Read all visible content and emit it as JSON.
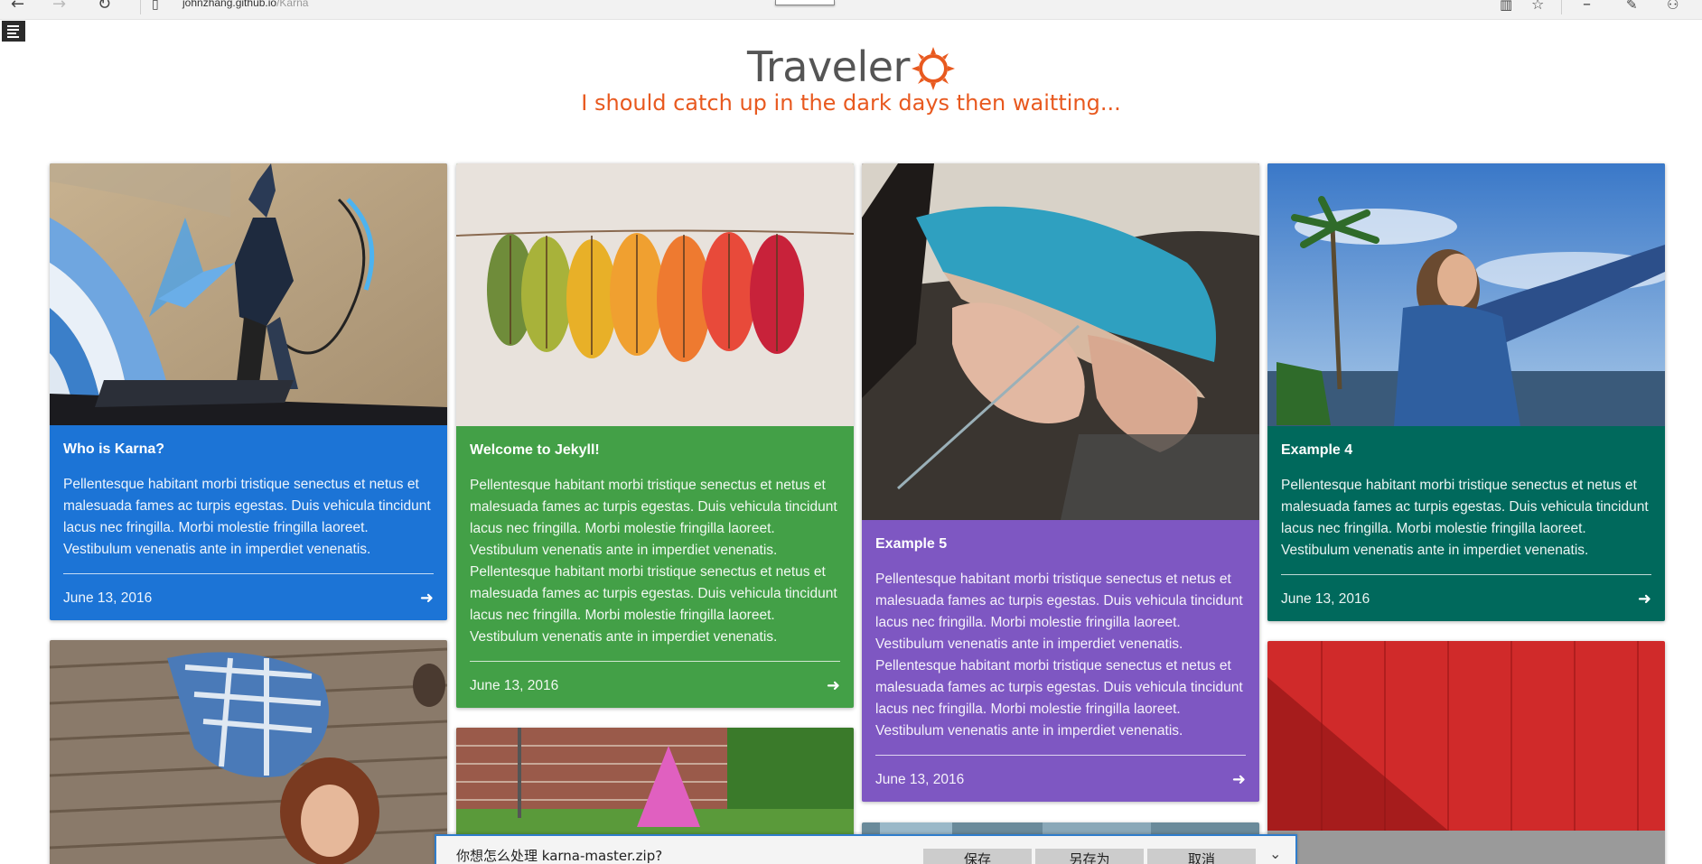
{
  "browser": {
    "url_host": "johnzhang.github.io",
    "url_path": "/Karna"
  },
  "site": {
    "title": "Traveler",
    "tagline": "I should catch up in the dark days then waitting..."
  },
  "posts": [
    {
      "title": "Who is Karna?",
      "excerpt": "Pellentesque habitant morbi tristique senectus et netus et malesuada fames ac turpis egestas. Duis vehicula tincidunt lacus nec fringilla. Morbi molestie fringilla laoreet. Vestibulum venenatis ante in imperdiet venenatis.",
      "date": "June 13, 2016",
      "color": "#1c74d6",
      "image": "archer-illustration"
    },
    {
      "title": "Welcome to Jekyll!",
      "excerpt": "Pellentesque habitant morbi tristique senectus et netus et malesuada fames ac turpis egestas. Duis vehicula tincidunt lacus nec fringilla. Morbi molestie fringilla laoreet. Vestibulum venenatis ante in imperdiet venenatis. Pellentesque habitant morbi tristique senectus et netus et malesuada fames ac turpis egestas. Duis vehicula tincidunt lacus nec fringilla. Morbi molestie fringilla laoreet. Vestibulum venenatis ante in imperdiet venenatis.",
      "date": "June 13, 2016",
      "color": "#43a047",
      "image": "autumn-leaves"
    },
    {
      "title": "Example 5",
      "excerpt": "Pellentesque habitant morbi tristique senectus et netus et malesuada fames ac turpis egestas. Duis vehicula tincidunt lacus nec fringilla. Morbi molestie fringilla laoreet. Vestibulum venenatis ante in imperdiet venenatis. Pellentesque habitant morbi tristique senectus et netus et malesuada fames ac turpis egestas. Duis vehicula tincidunt lacus nec fringilla. Morbi molestie fringilla laoreet. Vestibulum venenatis ante in imperdiet venenatis.",
      "date": "June 13, 2016",
      "color": "#7e57c2",
      "image": "shoemaker-hands"
    },
    {
      "title": "Example 4",
      "excerpt": "Pellentesque habitant morbi tristique senectus et netus et malesuada fames ac turpis egestas. Duis vehicula tincidunt lacus nec fringilla. Morbi molestie fringilla laoreet. Vestibulum venenatis ante in imperdiet venenatis.",
      "date": "June 13, 2016",
      "color": "#00695c",
      "image": "woman-seaside"
    }
  ],
  "download": {
    "prompt": "你想怎么处理 karna-master.zip?",
    "save_label": "保存",
    "save_as_label": "另存为",
    "cancel_label": "取消"
  }
}
